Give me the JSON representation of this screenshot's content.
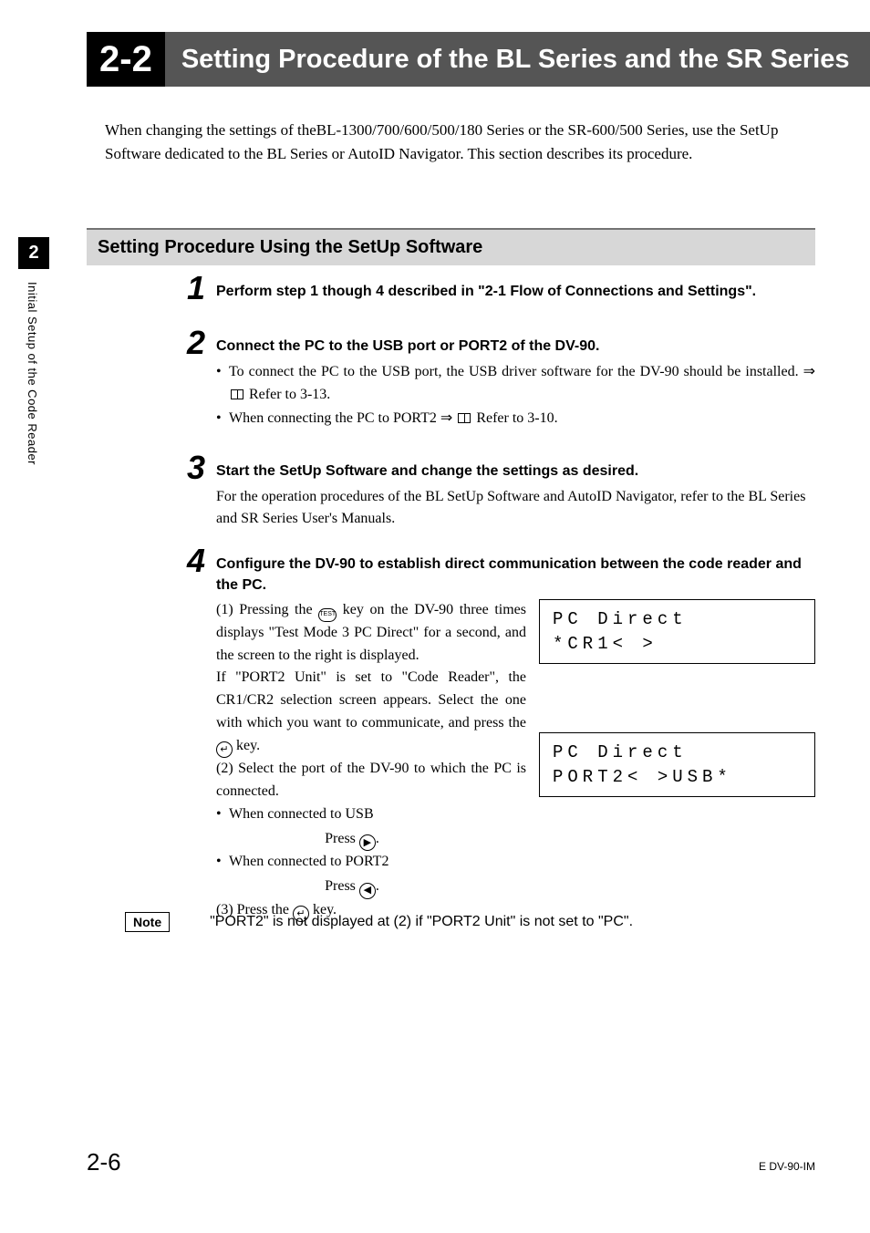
{
  "header": {
    "section_num": "2-2",
    "title": "Setting Procedure of the BL Series and the SR Series"
  },
  "intro": "When changing the settings of theBL-1300/700/600/500/180 Series or the SR-600/500 Series, use the SetUp Software dedicated to the BL Series or AutoID Navigator. This section describes its procedure.",
  "sidebar": {
    "chapter_num": "2",
    "chapter_title": "Initial Setup of the Code Reader"
  },
  "subhead": "Setting Procedure Using the SetUp Software",
  "steps": {
    "s1": {
      "num": "1",
      "title": "Perform step 1 though 4 described in \"2-1 Flow of Connections and Settings\"."
    },
    "s2": {
      "num": "2",
      "title": "Connect the PC to the USB port or PORT2 of the DV-90.",
      "b1a": "To connect the PC to the USB port, the USB driver software for the DV-90 should be installed. ⇒ ",
      "b1b": " Refer to 3-13.",
      "b2a": "When connecting the PC to PORT2  ⇒ ",
      "b2b": " Refer to 3-10."
    },
    "s3": {
      "num": "3",
      "title": "Start the SetUp Software and change the settings as desired.",
      "body": "For the operation procedures of the BL SetUp Software and AutoID Navigator, refer to the BL Series and SR Series User's Manuals."
    },
    "s4": {
      "num": "4",
      "title": "Configure the DV-90 to establish direct communication between the code reader and the PC.",
      "p1a": "(1) Pressing the ",
      "p1b": " key on the DV-90 three times displays \"Test Mode 3 PC Direct\" for a second, and the screen to the right is displayed.",
      "p2a": "If \"PORT2 Unit\" is set to \"Code Reader\", the CR1/CR2 selection screen appears. Select the one with which you want to communicate, and press the ",
      "p2b": " key.",
      "p3": "(2) Select the port of the DV-90 to which the PC is connected.",
      "b1": "When connected to USB",
      "press1a": "Press ",
      "press1b": ".",
      "b2": "When connected to PORT2",
      "press2a": "Press ",
      "press2b": ".",
      "p4a": "(3) Press the ",
      "p4b": " key.",
      "lcd1_l1": "PC Direct",
      "lcd1_l2": "   *CR1< >",
      "lcd2_l1": "PC Direct",
      "lcd2_l2": " PORT2< >USB*",
      "test_key": "TEST"
    }
  },
  "note": {
    "label": "Note",
    "text": "\"PORT2\" is not displayed at (2) if \"PORT2 Unit\" is not set to \"PC\"."
  },
  "footer": {
    "pagenum": "2-6",
    "doccode": "E DV-90-IM"
  }
}
